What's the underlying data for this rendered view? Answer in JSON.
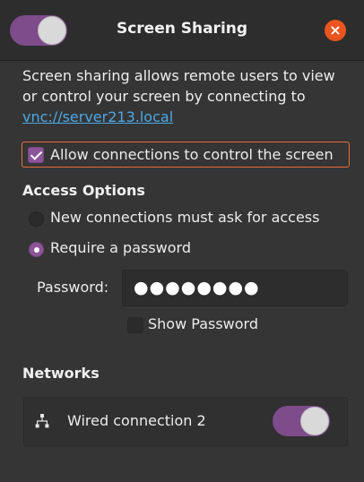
{
  "window": {
    "title": "Screen Sharing"
  },
  "header": {
    "sharing_toggle_on": true,
    "close_symbol": "×"
  },
  "description": {
    "text": "Screen sharing allows remote users to view or control your screen by connecting to",
    "link": "vnc://server213.local"
  },
  "allow_control": {
    "label": "Allow connections to control the screen",
    "checked": true
  },
  "access_options": {
    "heading": "Access Options",
    "options": [
      {
        "label": "New connections must ask for access",
        "selected": false
      },
      {
        "label": "Require a password",
        "selected": true
      }
    ]
  },
  "password": {
    "label": "Password:",
    "value": "●●●●●●●●",
    "show_label": "Show Password",
    "show_checked": false
  },
  "networks": {
    "heading": "Networks",
    "items": [
      {
        "label": "Wired connection 2",
        "enabled": true,
        "icon": "network-wired-icon"
      }
    ]
  },
  "colors": {
    "accent": "#7e4b8b",
    "close": "#e9541f",
    "link": "#4aa8e6",
    "focus": "#e96b3b"
  }
}
